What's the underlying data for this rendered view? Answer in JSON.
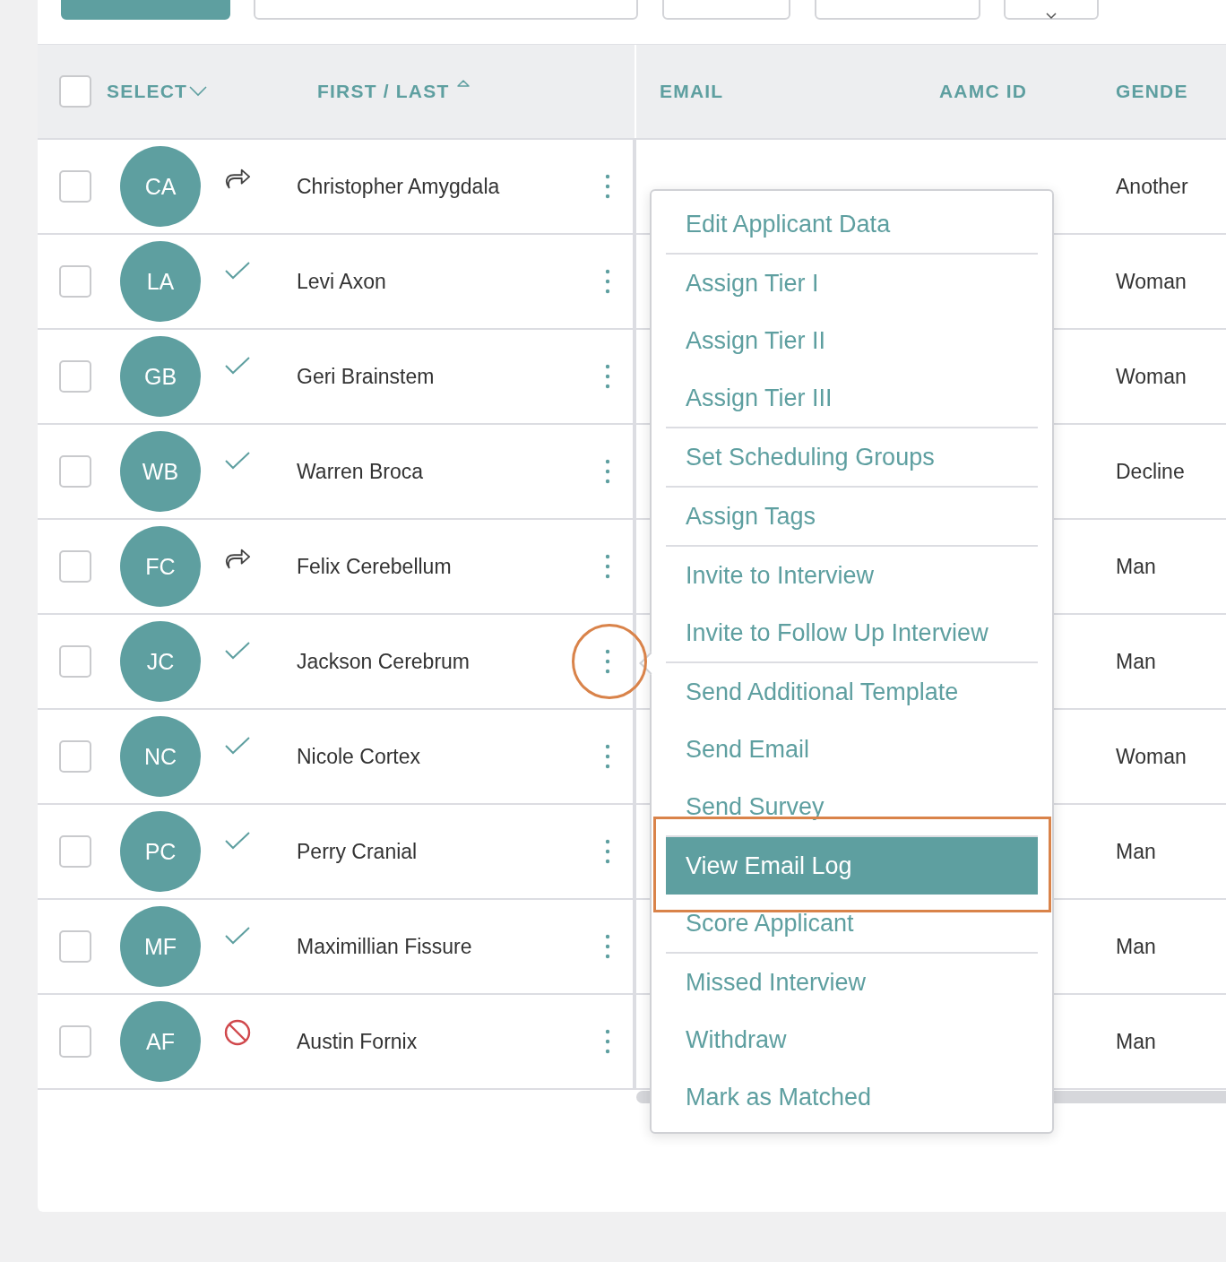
{
  "toolbar": [
    {
      "kind": "primary"
    },
    {
      "kind": "field"
    },
    {
      "kind": "button"
    },
    {
      "kind": "button"
    },
    {
      "kind": "dropdown"
    }
  ],
  "header": {
    "select_all_checked": false,
    "select_label": "SELECT",
    "name_label": "FIRST / LAST",
    "columns": [
      "EMAIL",
      "AAMC ID",
      "GENDE"
    ]
  },
  "rows": [
    {
      "checked": false,
      "initials": "CA",
      "kind": "forward",
      "name": "Christopher Amygdala",
      "gender": "Another"
    },
    {
      "checked": false,
      "initials": "LA",
      "kind": "check",
      "name": "Levi Axon",
      "gender": "Woman"
    },
    {
      "checked": false,
      "initials": "GB",
      "kind": "check",
      "name": "Geri Brainstem",
      "gender": "Woman"
    },
    {
      "checked": false,
      "initials": "WB",
      "kind": "check",
      "name": "Warren Broca",
      "gender": "Decline"
    },
    {
      "checked": false,
      "initials": "FC",
      "kind": "forward",
      "name": "Felix Cerebellum",
      "gender": "Man"
    },
    {
      "checked": false,
      "initials": "JC",
      "kind": "check",
      "name": "Jackson Cerebrum",
      "gender": "Man"
    },
    {
      "checked": false,
      "initials": "NC",
      "kind": "check",
      "name": "Nicole Cortex",
      "gender": "Woman"
    },
    {
      "checked": false,
      "initials": "PC",
      "kind": "check",
      "name": "Perry Cranial",
      "gender": "Man"
    },
    {
      "checked": false,
      "initials": "MF",
      "kind": "check",
      "name": "Maximillian Fissure",
      "gender": "Man"
    },
    {
      "checked": false,
      "initials": "AF",
      "kind": "blocked",
      "name": "Austin Fornix",
      "gender": "Man"
    }
  ],
  "action_menu": {
    "groups": [
      [
        {
          "label": "Edit Applicant Data",
          "selected": false
        }
      ],
      [
        {
          "label": "Assign Tier I",
          "selected": false
        },
        {
          "label": "Assign Tier II",
          "selected": false
        },
        {
          "label": "Assign Tier III",
          "selected": false
        }
      ],
      [
        {
          "label": "Set Scheduling Groups",
          "selected": false
        }
      ],
      [
        {
          "label": "Assign Tags",
          "selected": false
        }
      ],
      [
        {
          "label": "Invite to Interview",
          "selected": false
        },
        {
          "label": "Invite to Follow Up Interview",
          "selected": false
        }
      ],
      [
        {
          "label": "Send Additional Template",
          "selected": false
        },
        {
          "label": "Send Email",
          "selected": false
        },
        {
          "label": "Send Survey",
          "selected": false
        }
      ],
      [
        {
          "label": "View Email Log",
          "selected": true
        },
        {
          "label": "Score Applicant",
          "selected": false
        }
      ],
      [
        {
          "label": "Missed Interview",
          "selected": false
        },
        {
          "label": "Withdraw",
          "selected": false
        },
        {
          "label": "Mark as Matched",
          "selected": false
        }
      ]
    ]
  }
}
